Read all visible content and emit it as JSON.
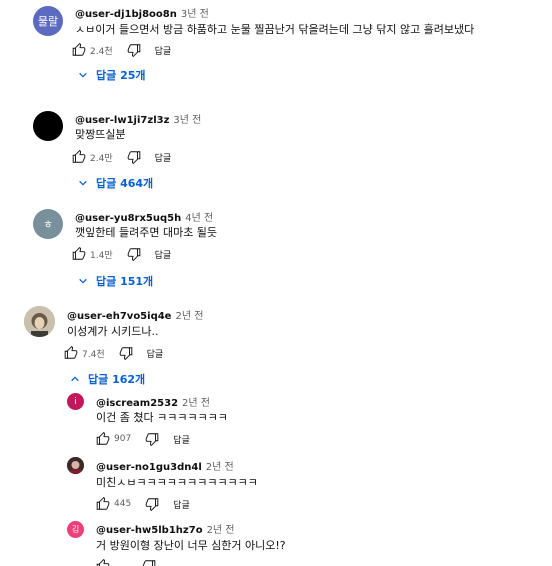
{
  "comments": [
    {
      "avatar_text": "물랄",
      "avatar_color": "#5c6bc0",
      "author": "@user-dj1bj8oo8n",
      "time": "3년 전",
      "text": "ㅅㅂ이거 들으면서 방금 하품하고  눈물 찔끔난거 닦을려는데 그냥 닦지 않고 흘려보냈다",
      "likes": "2.4천",
      "reply_label": "답글",
      "replies_label": "답글 25개"
    },
    {
      "avatar_text": "",
      "avatar_color": "#000000",
      "author": "@user-lw1ji7zl3z",
      "time": "3년 전",
      "text": "맞짱뜨실분",
      "likes": "2.4만",
      "reply_label": "답글",
      "replies_label": "답글 464개"
    },
    {
      "avatar_text": "ㅎ",
      "avatar_color": "#78909c",
      "author": "@user-yu8rx5uq5h",
      "time": "4년 전",
      "text": "깻잎한테 들려주면 대마초 될듯",
      "likes": "1.4만",
      "reply_label": "답글",
      "replies_label": "답글 151개"
    },
    {
      "avatar_text": "",
      "avatar_color": "#b9b0a0",
      "author": "@user-eh7vo5iq4e",
      "time": "2년 전",
      "text": "이성계가 시키드나..",
      "likes": "7.4천",
      "reply_label": "답글",
      "replies_label": "답글 162개"
    }
  ],
  "replies": [
    {
      "avatar_text": "i",
      "avatar_color": "#c2185b",
      "author": "@iscream2532",
      "time": "2년 전",
      "text": "이건 좀 쳤다 ㅋㅋㅋㅋㅋㅋㅋ",
      "likes": "907",
      "reply_label": "답글"
    },
    {
      "avatar_text": "",
      "avatar_color": "#5d4037",
      "author": "@user-no1gu3dn4l",
      "time": "2년 전",
      "text": "미친ㅅㅂㅋㅋㅋㅋㅋㅋㅋㅋㅋㅋㅋㅋ",
      "likes": "445",
      "reply_label": "답글"
    },
    {
      "avatar_text": "김",
      "avatar_color": "#ec407a",
      "author": "@user-hw5lb1hz7o",
      "time": "2년 전",
      "text": "거 방원이형 장난이 너무 심한거 아니오!?",
      "likes": "",
      "reply_label": "답글"
    }
  ],
  "colors": {
    "link": "#065fd4",
    "meta": "#606060"
  },
  "icons": [
    "thumb-up-icon",
    "thumb-down-icon",
    "chevron-down-icon",
    "chevron-up-icon"
  ]
}
